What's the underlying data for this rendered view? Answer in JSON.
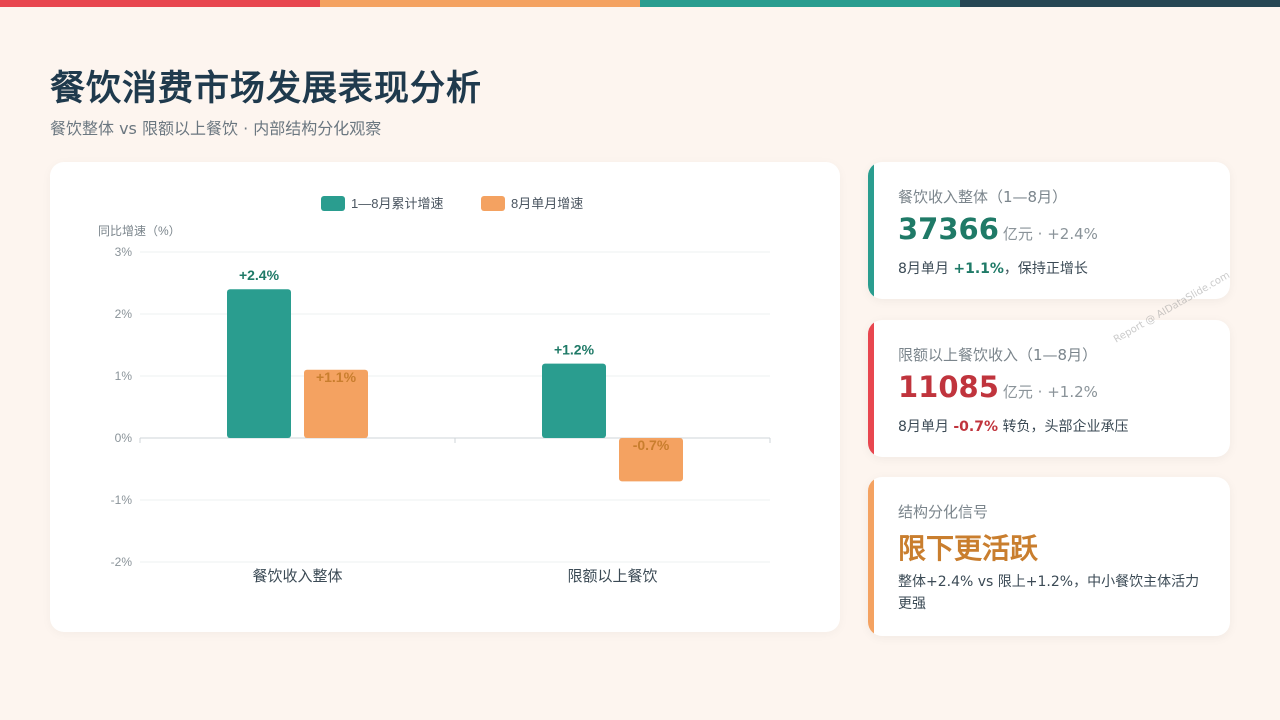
{
  "colors": {
    "topbar": [
      "#e8464f",
      "#f4a261",
      "#2a9d8f",
      "#264653"
    ],
    "series1": "#2a9d8f",
    "series2": "#f4a261",
    "positive": "#1f7a67",
    "negative": "#c0343d",
    "orange_text": "#c97e2e"
  },
  "header": {
    "title": "餐饮消费市场发展表现分析",
    "subtitle": "餐饮整体 vs 限额以上餐饮 · 内部结构分化观察"
  },
  "chart_data": {
    "type": "bar",
    "ylabel": "同比增速（%）",
    "categories": [
      "餐饮收入整体",
      "限额以上餐饮"
    ],
    "series": [
      {
        "name": "1—8月累计增速",
        "values": [
          2.4,
          1.2
        ],
        "labels": [
          "+2.4%",
          "+1.2%"
        ]
      },
      {
        "name": "8月单月增速",
        "values": [
          1.1,
          -0.7
        ],
        "labels": [
          "+1.1%",
          "-0.7%"
        ]
      }
    ],
    "ylim": [
      -2,
      3
    ],
    "yticks": [
      "3%",
      "2%",
      "1%",
      "0%",
      "-1%",
      "-2%"
    ],
    "ytick_values": [
      3,
      2,
      1,
      0,
      -1,
      -2
    ],
    "legend": "top-center",
    "grid": true
  },
  "kpis": [
    {
      "title": "餐饮收入整体（1—8月）",
      "value": "37366",
      "unit": "亿元 · +2.4%",
      "note_prefix": "8月单月 ",
      "note_highlight": "+1.1%",
      "note_suffix": "，保持正增长"
    },
    {
      "title": "限额以上餐饮收入（1—8月）",
      "value": "11085",
      "unit": "亿元 · +1.2%",
      "note_prefix": "8月单月 ",
      "note_highlight": "-0.7%",
      "note_suffix": " 转负，头部企业承压"
    },
    {
      "title": "结构分化信号",
      "headline": "限下更活跃",
      "note": "整体+2.4% vs 限上+1.2%，中小餐饮主体活力更强"
    }
  ],
  "watermark": "Report @ AIDataSlide.com"
}
